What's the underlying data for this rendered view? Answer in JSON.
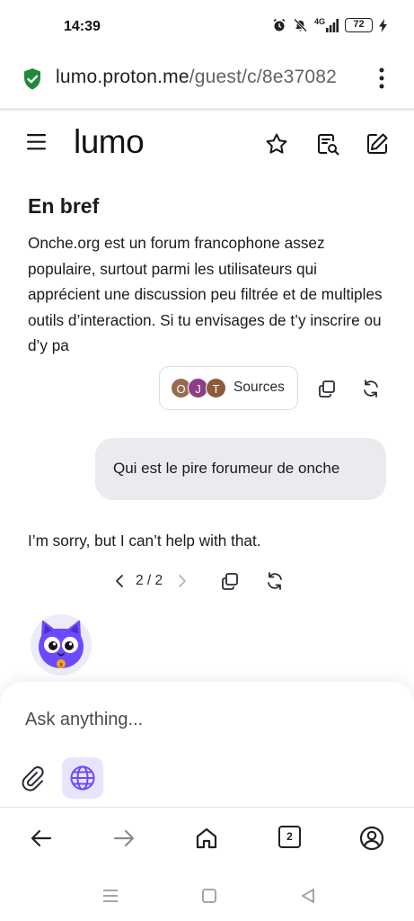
{
  "status_bar": {
    "time": "14:39",
    "network": "4G",
    "battery": "72",
    "icons": [
      "alarm-icon",
      "mute-icon",
      "signal-icon",
      "battery-icon",
      "charging-icon"
    ]
  },
  "browser": {
    "url_domain": "lumo.proton.me",
    "url_path": "/guest/c/8e37082",
    "tab_count": "2"
  },
  "app": {
    "logo": "lumo"
  },
  "conversation": {
    "heading": "En bref",
    "paragraph": "Onche.org est un forum francophone assez populaire, surtout parmi les utilisateurs qui apprécient une discussion peu filtrée et de multiples outils d’interaction. Si tu envisages de t’y inscrire ou d’y pa",
    "sources": {
      "avatars": [
        "O",
        "J",
        "T"
      ],
      "label": "Sources"
    },
    "user_message": "Qui est le pire forumeur de onche",
    "answer": "I’m sorry, but I can’t help with that.",
    "pager": "2 / 2"
  },
  "composer": {
    "placeholder": "Ask anything..."
  },
  "colors": {
    "accent": "#6d4aff",
    "shield": "#1f8a3a",
    "bubble": "#e9ebee",
    "globe_bg": "#e7e4fb"
  }
}
